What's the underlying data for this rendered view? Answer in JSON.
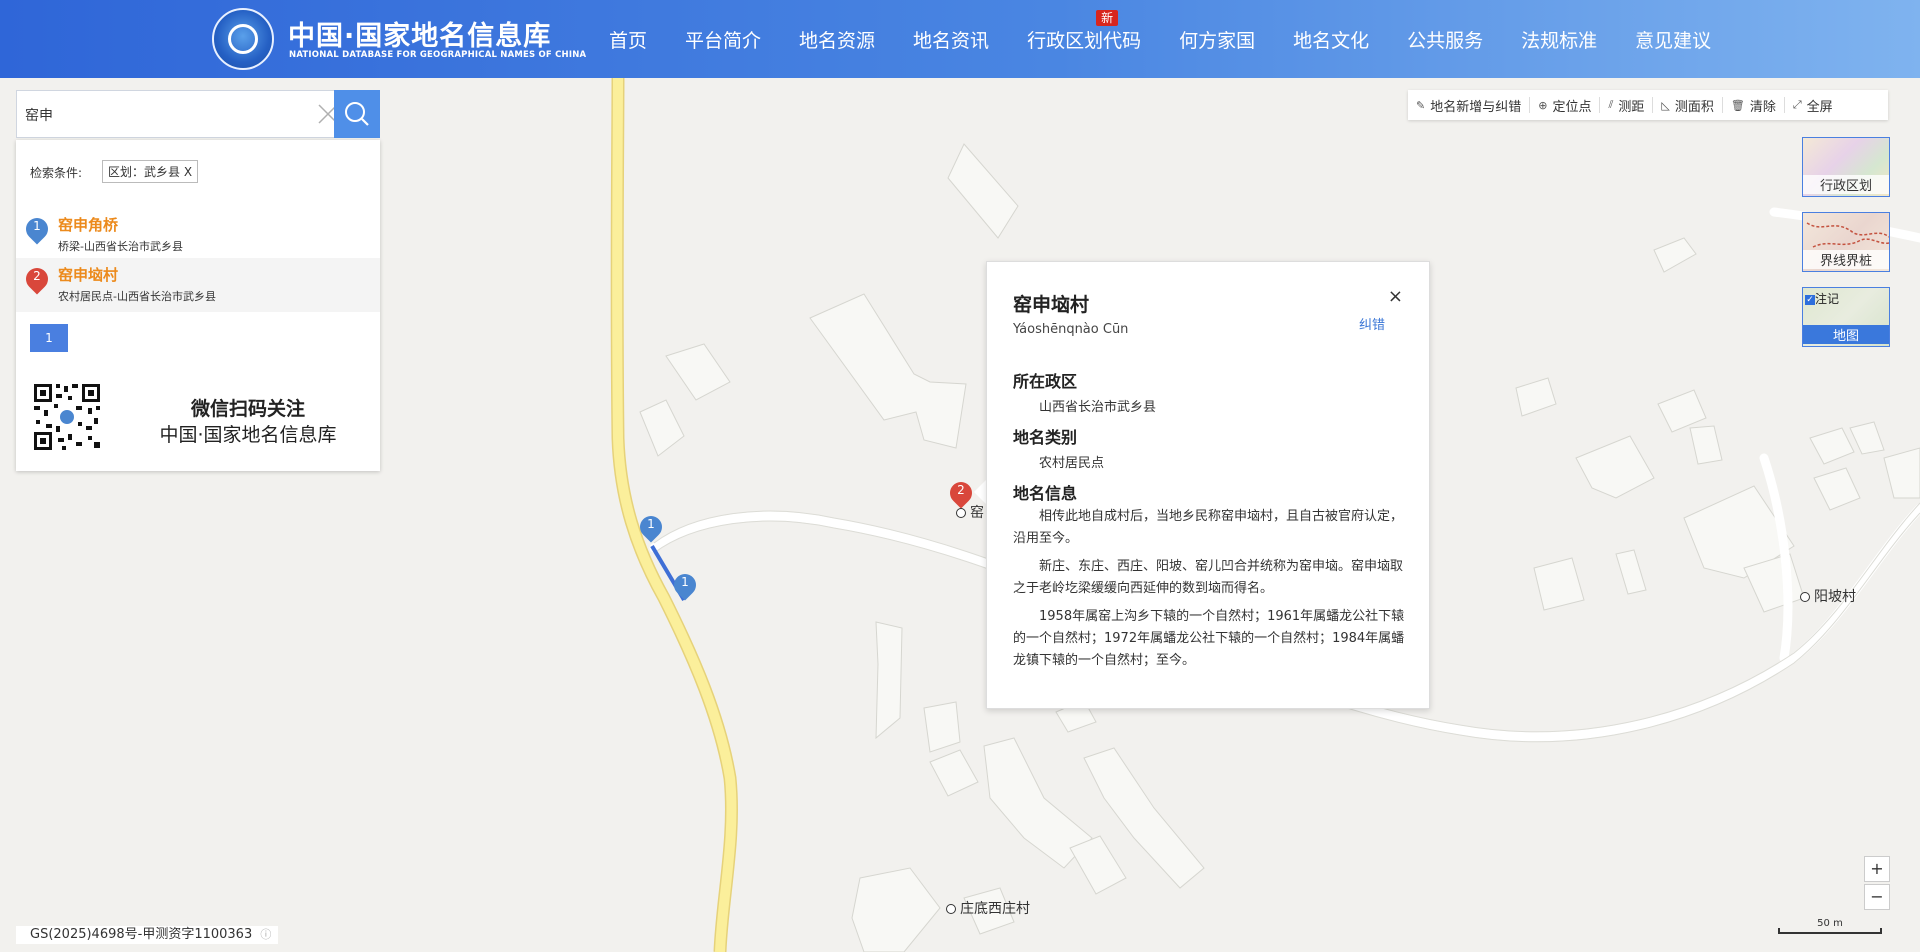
{
  "header": {
    "title": "中国·国家地名信息库",
    "subtitle": "NATIONAL DATABASE FOR GEOGRAPHICAL NAMES OF CHINA",
    "nav": [
      "首页",
      "平台简介",
      "地名资源",
      "地名资讯",
      "行政区划代码",
      "何方家国",
      "地名文化",
      "公共服务",
      "法规标准",
      "意见建议"
    ],
    "new_badge": "新"
  },
  "search": {
    "value": "窑申",
    "filter_label": "检索条件:",
    "filter_tag": "区划：武乡县 X",
    "results": [
      {
        "num": "1",
        "name": "窑申角桥",
        "desc": "桥梁-山西省长治市武乡县",
        "color": "#4a86d0"
      },
      {
        "num": "2",
        "name": "窑申垴村",
        "desc": "农村居民点-山西省长治市武乡县",
        "color": "#d9473b"
      }
    ],
    "page": "1",
    "qr_title": "微信扫码关注",
    "qr_sub": "中国·国家地名信息库"
  },
  "toolbar": [
    "地名新增与纠错",
    "定位点",
    "测距",
    "测面积",
    "清除",
    "全屏"
  ],
  "layers": {
    "admin": "行政区划",
    "boundary": "界线界桩",
    "annotation": "注记",
    "map": "地图"
  },
  "popup": {
    "title": "窑申垴村",
    "pinyin": "Yáoshēnqnào Cūn",
    "correct": "纠错",
    "close": "×",
    "region_h": "所在政区",
    "region_v": "山西省长治市武乡县",
    "type_h": "地名类别",
    "type_v": "农村居民点",
    "info_h": "地名信息",
    "info_p1": "相传此地自成村后，当地乡民称窑申垴村，且自古被官府认定，沿用至今。",
    "info_p2": "新庄、东庄、西庄、阳坡、窑儿凹合并统称为窑申垴。窑申垴取之于老岭圪梁缓缓向西延伸的数到垴而得名。",
    "info_p3": "1958年属窑上沟乡下辕的一个自然村；1961年属蟠龙公社下辕的一个自然村；1972年属蟠龙公社下辕的一个自然村；1984年属蟠龙镇下辕的一个自然村；至今。"
  },
  "map": {
    "labels": {
      "yaoshen_partial": "窑",
      "yangpo": "阳坡村",
      "zhuangdi": "庄底西庄村"
    },
    "markers": [
      "1",
      "1",
      "2"
    ]
  },
  "zoom": {
    "in": "+",
    "out": "−"
  },
  "copyright": "GS(2025)4698号-甲测资字1100363",
  "scale": "50 m"
}
